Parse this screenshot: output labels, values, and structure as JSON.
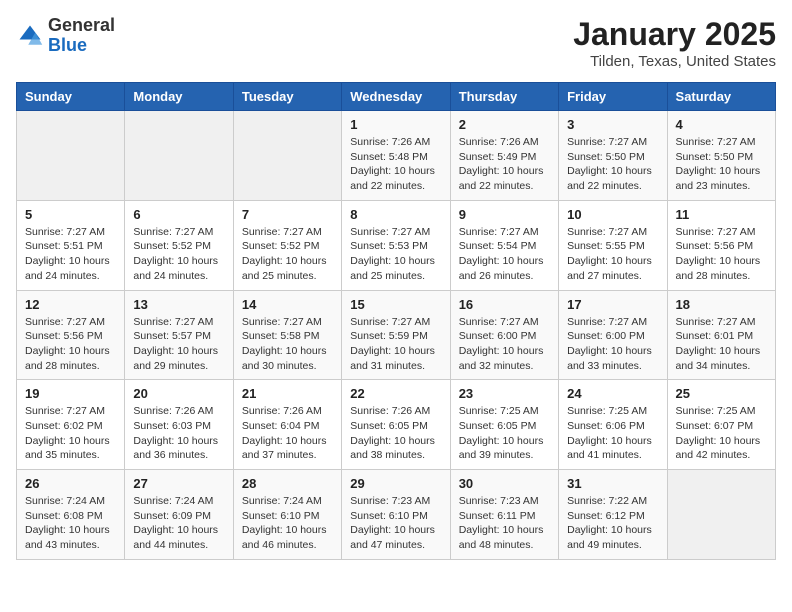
{
  "logo": {
    "general": "General",
    "blue": "Blue"
  },
  "header": {
    "title": "January 2025",
    "location": "Tilden, Texas, United States"
  },
  "days_of_week": [
    "Sunday",
    "Monday",
    "Tuesday",
    "Wednesday",
    "Thursday",
    "Friday",
    "Saturday"
  ],
  "weeks": [
    [
      {
        "day": "",
        "sunrise": "",
        "sunset": "",
        "daylight": ""
      },
      {
        "day": "",
        "sunrise": "",
        "sunset": "",
        "daylight": ""
      },
      {
        "day": "",
        "sunrise": "",
        "sunset": "",
        "daylight": ""
      },
      {
        "day": "1",
        "sunrise": "Sunrise: 7:26 AM",
        "sunset": "Sunset: 5:48 PM",
        "daylight": "Daylight: 10 hours and 22 minutes."
      },
      {
        "day": "2",
        "sunrise": "Sunrise: 7:26 AM",
        "sunset": "Sunset: 5:49 PM",
        "daylight": "Daylight: 10 hours and 22 minutes."
      },
      {
        "day": "3",
        "sunrise": "Sunrise: 7:27 AM",
        "sunset": "Sunset: 5:50 PM",
        "daylight": "Daylight: 10 hours and 22 minutes."
      },
      {
        "day": "4",
        "sunrise": "Sunrise: 7:27 AM",
        "sunset": "Sunset: 5:50 PM",
        "daylight": "Daylight: 10 hours and 23 minutes."
      }
    ],
    [
      {
        "day": "5",
        "sunrise": "Sunrise: 7:27 AM",
        "sunset": "Sunset: 5:51 PM",
        "daylight": "Daylight: 10 hours and 24 minutes."
      },
      {
        "day": "6",
        "sunrise": "Sunrise: 7:27 AM",
        "sunset": "Sunset: 5:52 PM",
        "daylight": "Daylight: 10 hours and 24 minutes."
      },
      {
        "day": "7",
        "sunrise": "Sunrise: 7:27 AM",
        "sunset": "Sunset: 5:52 PM",
        "daylight": "Daylight: 10 hours and 25 minutes."
      },
      {
        "day": "8",
        "sunrise": "Sunrise: 7:27 AM",
        "sunset": "Sunset: 5:53 PM",
        "daylight": "Daylight: 10 hours and 25 minutes."
      },
      {
        "day": "9",
        "sunrise": "Sunrise: 7:27 AM",
        "sunset": "Sunset: 5:54 PM",
        "daylight": "Daylight: 10 hours and 26 minutes."
      },
      {
        "day": "10",
        "sunrise": "Sunrise: 7:27 AM",
        "sunset": "Sunset: 5:55 PM",
        "daylight": "Daylight: 10 hours and 27 minutes."
      },
      {
        "day": "11",
        "sunrise": "Sunrise: 7:27 AM",
        "sunset": "Sunset: 5:56 PM",
        "daylight": "Daylight: 10 hours and 28 minutes."
      }
    ],
    [
      {
        "day": "12",
        "sunrise": "Sunrise: 7:27 AM",
        "sunset": "Sunset: 5:56 PM",
        "daylight": "Daylight: 10 hours and 28 minutes."
      },
      {
        "day": "13",
        "sunrise": "Sunrise: 7:27 AM",
        "sunset": "Sunset: 5:57 PM",
        "daylight": "Daylight: 10 hours and 29 minutes."
      },
      {
        "day": "14",
        "sunrise": "Sunrise: 7:27 AM",
        "sunset": "Sunset: 5:58 PM",
        "daylight": "Daylight: 10 hours and 30 minutes."
      },
      {
        "day": "15",
        "sunrise": "Sunrise: 7:27 AM",
        "sunset": "Sunset: 5:59 PM",
        "daylight": "Daylight: 10 hours and 31 minutes."
      },
      {
        "day": "16",
        "sunrise": "Sunrise: 7:27 AM",
        "sunset": "Sunset: 6:00 PM",
        "daylight": "Daylight: 10 hours and 32 minutes."
      },
      {
        "day": "17",
        "sunrise": "Sunrise: 7:27 AM",
        "sunset": "Sunset: 6:00 PM",
        "daylight": "Daylight: 10 hours and 33 minutes."
      },
      {
        "day": "18",
        "sunrise": "Sunrise: 7:27 AM",
        "sunset": "Sunset: 6:01 PM",
        "daylight": "Daylight: 10 hours and 34 minutes."
      }
    ],
    [
      {
        "day": "19",
        "sunrise": "Sunrise: 7:27 AM",
        "sunset": "Sunset: 6:02 PM",
        "daylight": "Daylight: 10 hours and 35 minutes."
      },
      {
        "day": "20",
        "sunrise": "Sunrise: 7:26 AM",
        "sunset": "Sunset: 6:03 PM",
        "daylight": "Daylight: 10 hours and 36 minutes."
      },
      {
        "day": "21",
        "sunrise": "Sunrise: 7:26 AM",
        "sunset": "Sunset: 6:04 PM",
        "daylight": "Daylight: 10 hours and 37 minutes."
      },
      {
        "day": "22",
        "sunrise": "Sunrise: 7:26 AM",
        "sunset": "Sunset: 6:05 PM",
        "daylight": "Daylight: 10 hours and 38 minutes."
      },
      {
        "day": "23",
        "sunrise": "Sunrise: 7:25 AM",
        "sunset": "Sunset: 6:05 PM",
        "daylight": "Daylight: 10 hours and 39 minutes."
      },
      {
        "day": "24",
        "sunrise": "Sunrise: 7:25 AM",
        "sunset": "Sunset: 6:06 PM",
        "daylight": "Daylight: 10 hours and 41 minutes."
      },
      {
        "day": "25",
        "sunrise": "Sunrise: 7:25 AM",
        "sunset": "Sunset: 6:07 PM",
        "daylight": "Daylight: 10 hours and 42 minutes."
      }
    ],
    [
      {
        "day": "26",
        "sunrise": "Sunrise: 7:24 AM",
        "sunset": "Sunset: 6:08 PM",
        "daylight": "Daylight: 10 hours and 43 minutes."
      },
      {
        "day": "27",
        "sunrise": "Sunrise: 7:24 AM",
        "sunset": "Sunset: 6:09 PM",
        "daylight": "Daylight: 10 hours and 44 minutes."
      },
      {
        "day": "28",
        "sunrise": "Sunrise: 7:24 AM",
        "sunset": "Sunset: 6:10 PM",
        "daylight": "Daylight: 10 hours and 46 minutes."
      },
      {
        "day": "29",
        "sunrise": "Sunrise: 7:23 AM",
        "sunset": "Sunset: 6:10 PM",
        "daylight": "Daylight: 10 hours and 47 minutes."
      },
      {
        "day": "30",
        "sunrise": "Sunrise: 7:23 AM",
        "sunset": "Sunset: 6:11 PM",
        "daylight": "Daylight: 10 hours and 48 minutes."
      },
      {
        "day": "31",
        "sunrise": "Sunrise: 7:22 AM",
        "sunset": "Sunset: 6:12 PM",
        "daylight": "Daylight: 10 hours and 49 minutes."
      },
      {
        "day": "",
        "sunrise": "",
        "sunset": "",
        "daylight": ""
      }
    ]
  ]
}
